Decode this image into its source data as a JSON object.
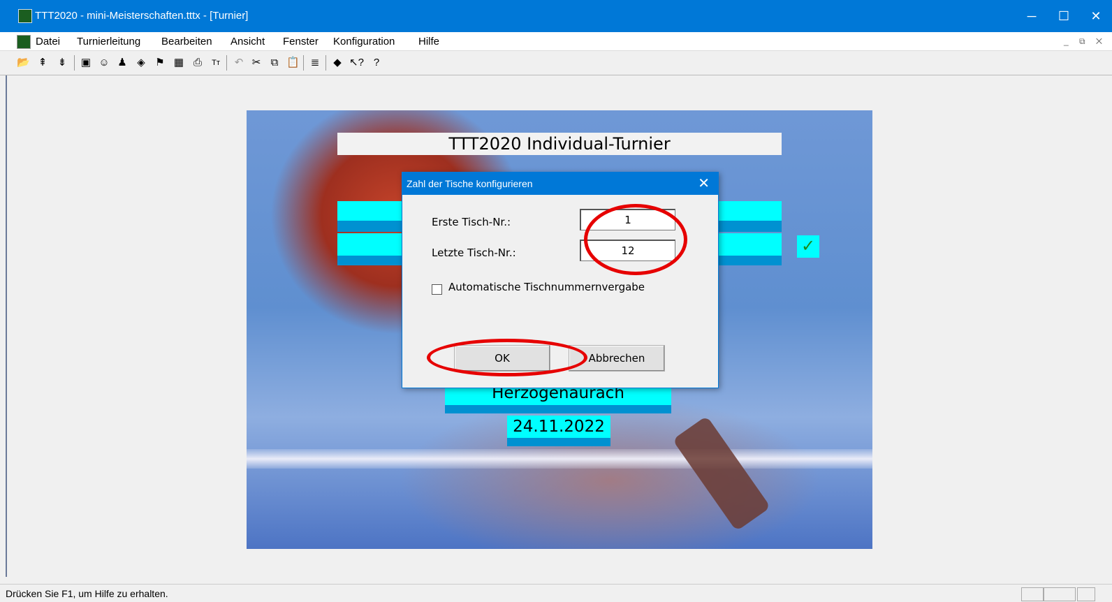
{
  "window": {
    "title": "TTT2020 - mini-Meisterschaften.tttx - [Turnier]"
  },
  "menu": [
    "Datei",
    "Turnierleitung",
    "Bearbeiten",
    "Ansicht",
    "Fenster",
    "Konfiguration",
    "Hilfe"
  ],
  "toolbar_icons": [
    "open-icon",
    "tree-up-icon",
    "tree-down-icon",
    "window-icon",
    "player-icon",
    "group-icon",
    "box-icon",
    "handshake-icon",
    "calendar-icon",
    "print-icon",
    "font-size-icon",
    "undo-icon",
    "cut-icon",
    "copy-icon",
    "paste-icon",
    "list-icon",
    "book-icon",
    "context-help-icon",
    "help-icon"
  ],
  "banner": {
    "title": "TTT2020 Individual-Turnier",
    "location": "Herzogenaurach",
    "date": "24.11.2022",
    "check": "✓"
  },
  "dialog": {
    "title": "Zahl der Tische konfigurieren",
    "close": "✕",
    "first_label": "Erste Tisch-Nr.:",
    "first_value": "1",
    "last_label": "Letzte Tisch-Nr.:",
    "last_value": "12",
    "auto_label": "Automatische Tischnummernvergabe",
    "auto_checked": false,
    "ok": "OK",
    "cancel": "Abbrechen"
  },
  "status": {
    "text": "Drücken Sie F1, um Hilfe zu erhalten."
  },
  "annotation_color": "#e60000"
}
